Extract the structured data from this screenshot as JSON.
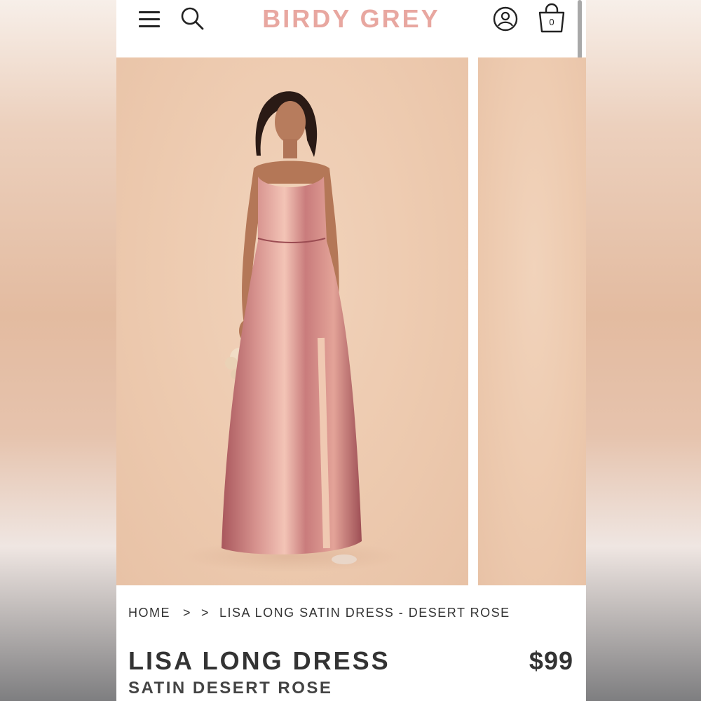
{
  "header": {
    "logo": "BIRDY GREY",
    "cart_count": "0",
    "icons": {
      "menu": "hamburger-menu-icon",
      "search": "search-icon",
      "account": "user-account-icon",
      "cart": "shopping-bag-icon"
    }
  },
  "gallery": {
    "main_image_desc": "model-in-satin-dress",
    "colors": {
      "background": "#edcaaf",
      "dress": "#c97c7c",
      "logo": "#e8a7a0"
    }
  },
  "breadcrumb": {
    "home": "HOME",
    "separator": ">",
    "current": "LISA LONG SATIN DRESS - DESERT ROSE"
  },
  "product": {
    "title": "LISA LONG DRESS",
    "subtitle": "SATIN DESERT ROSE",
    "price": "$99"
  }
}
